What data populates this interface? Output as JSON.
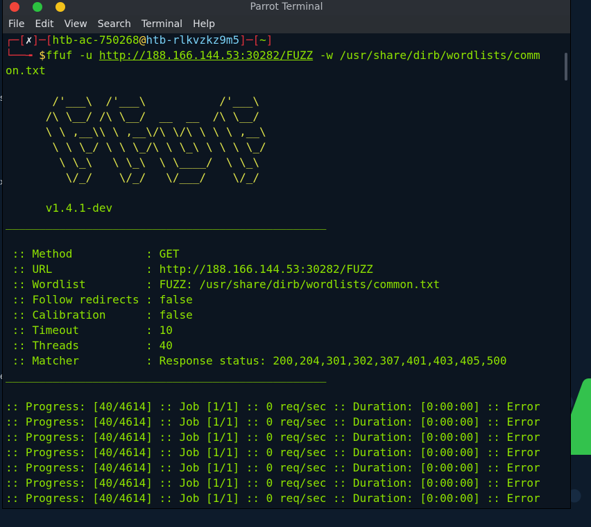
{
  "window": {
    "title": "Parrot Terminal",
    "menu": [
      "File",
      "Edit",
      "View",
      "Search",
      "Terminal",
      "Help"
    ]
  },
  "prompt": {
    "line1_prefix": "┌─[",
    "status": "✗",
    "sep1": "]─[",
    "user": "htb-ac-750268",
    "at": "@",
    "host": "htb-rlkvzkz9m5",
    "sep2": "]─[",
    "dir": "~",
    "end": "]",
    "line2_prefix": "└──╼ ",
    "dollar": "$",
    "cmd_start": "ffuf -u ",
    "url": "http://188.166.144.53:30282/FUZZ",
    "cmd_end": " -w /usr/share/dirb/wordlists/comm",
    "cmd_wrap": "on.txt"
  },
  "banner": [
    "       /'___\\  /'___\\           /'___\\",
    "      /\\ \\__/ /\\ \\__/  __  __  /\\ \\__/",
    "      \\ \\ ,__\\\\ \\ ,__\\/\\ \\/\\ \\ \\ \\ ,__\\",
    "       \\ \\ \\_/ \\ \\ \\_/\\ \\ \\_\\ \\ \\ \\ \\_/",
    "        \\ \\_\\   \\ \\_\\  \\ \\____/  \\ \\_\\",
    "         \\/_/    \\/_/   \\/___/    \\/_/"
  ],
  "version": "      v1.4.1-dev",
  "separator": "________________________________________________",
  "options": [
    {
      "key": " :: Method           ",
      "value": ": GET"
    },
    {
      "key": " :: URL              ",
      "value": ": http://188.166.144.53:30282/FUZZ"
    },
    {
      "key": " :: Wordlist         ",
      "value": ": FUZZ: /usr/share/dirb/wordlists/common.txt"
    },
    {
      "key": " :: Follow redirects ",
      "value": ": false"
    },
    {
      "key": " :: Calibration      ",
      "value": ": false"
    },
    {
      "key": " :: Timeout          ",
      "value": ": 10"
    },
    {
      "key": " :: Threads          ",
      "value": ": 40"
    },
    {
      "key": " :: Matcher          ",
      "value": ": Response status: 200,204,301,302,307,401,403,405,500"
    }
  ],
  "progress_line": ":: Progress: [40/4614] :: Job [1/1] :: 0 req/sec :: Duration: [0:00:00] :: Error",
  "progress_count": 7,
  "left_chars": [
    "s",
    "x",
    "e"
  ],
  "colors": {
    "text": "#8fe300",
    "prompt_red": "#e0313b",
    "host_cyan": "#79d0f5",
    "dollar_yellow": "#ffd845",
    "desktop_green": "#33c24d"
  }
}
